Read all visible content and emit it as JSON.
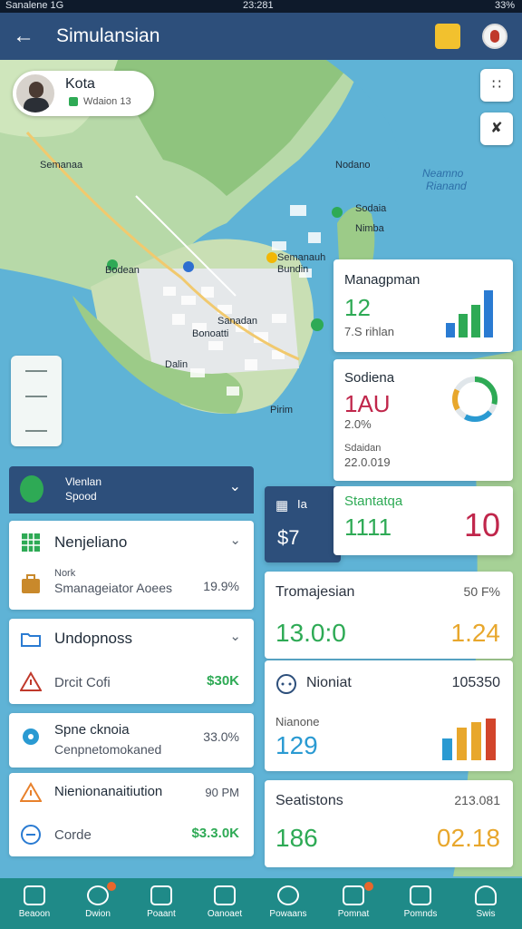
{
  "status": {
    "left": "Sanalene  1G",
    "center": "23:281",
    "right": "33%"
  },
  "header": {
    "title": "Simulansian"
  },
  "map": {
    "profile": {
      "name": "Kota",
      "sub": "Wdaion  13"
    },
    "labels": {
      "seminaa": "Semanaa",
      "nodano": "Nodano",
      "nearme": "Neamno",
      "riaiand": "Rianand",
      "sodaia": "Sodaia",
      "nimba": "Nimba",
      "semanauh": "Semanauh",
      "bundin": "Bundin",
      "bodean": "Bodean",
      "sanadan": "Sanadan",
      "bonoatti": "Bonoatti",
      "pirim": "Pirim",
      "dalin": "Dalin"
    }
  },
  "cards": {
    "management": {
      "title": "Managpman",
      "value": "12",
      "sub": "7.S rihlan"
    },
    "sodiena": {
      "title": "Sodiena",
      "value": "1AU",
      "pct": "2.0%",
      "caption": "Sdaidan",
      "sub": "22.0.019"
    },
    "stanta": {
      "title": "Stantatqa",
      "left": "1111",
      "right": "10"
    },
    "small": {
      "icon_label": "Ia",
      "value": "$7"
    }
  },
  "list": {
    "head": {
      "l1": "Vlenlan",
      "l2": "Spood"
    },
    "items": [
      {
        "title": "Nenjeliano",
        "label": "Nork",
        "sub": "Smanageiator Aoees",
        "value": "19.9%"
      },
      {
        "title": "Undopnoss",
        "sub": "Drcit Cofi",
        "value": "$30K"
      },
      {
        "title": "Spne cknoia",
        "sub": "Cenpnetomokaned",
        "value": "33.0%"
      },
      {
        "title": "Nienionanaitiution",
        "sub": "Corde",
        "value": "$3.3.0K",
        "right": "90 PM"
      }
    ]
  },
  "right": {
    "tromaj": {
      "label": "Tromajesian",
      "right": "50 F%",
      "value": "13.0:0",
      "delta": "1.24"
    },
    "noniat": {
      "label": "Nioniat",
      "right": "105350",
      "caption": "Nianone",
      "value": "129"
    },
    "seatis": {
      "label": "Seatistons",
      "right": "213.081",
      "value": "186",
      "value2": "02.18"
    }
  },
  "nav": [
    {
      "label": "Beaoon"
    },
    {
      "label": "Dwion"
    },
    {
      "label": "Poaant"
    },
    {
      "label": "Oanoaet"
    },
    {
      "label": "Powaans"
    },
    {
      "label": "Pomnat"
    },
    {
      "label": "Pomnds"
    },
    {
      "label": "Swis"
    }
  ]
}
